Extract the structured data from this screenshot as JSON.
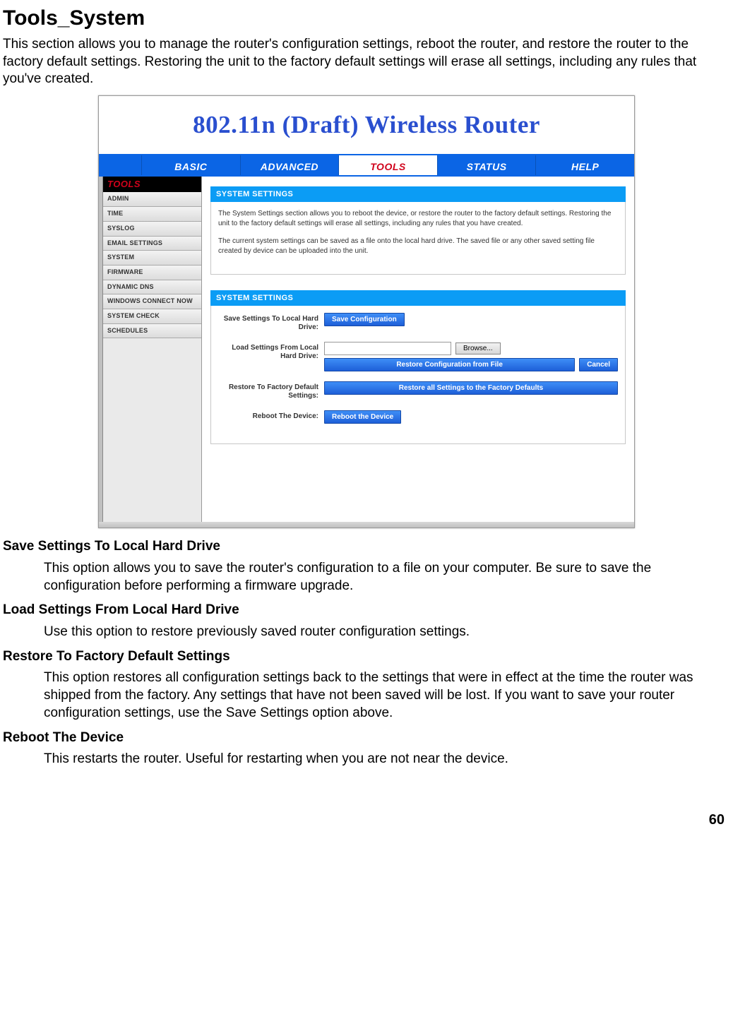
{
  "doc": {
    "title": "Tools_System",
    "intro": "This section allows you to manage the router's configuration settings, reboot the router, and restore the router to the factory default settings. Restoring the unit to the factory default settings will erase all settings, including any rules that you've created.",
    "page_number": "60"
  },
  "banner": {
    "title": "802.11n (Draft) Wireless Router"
  },
  "topnav": {
    "items": [
      "BASIC",
      "ADVANCED",
      "TOOLS",
      "STATUS",
      "HELP"
    ],
    "active_index": 2
  },
  "sidebar": {
    "header": "TOOLS",
    "items": [
      "ADMIN",
      "TIME",
      "SYSLOG",
      "EMAIL SETTINGS",
      "SYSTEM",
      "FIRMWARE",
      "DYNAMIC DNS",
      "WINDOWS CONNECT NOW",
      "SYSTEM CHECK",
      "SCHEDULES"
    ]
  },
  "panels": {
    "settings_title": "SYSTEM SETTINGS",
    "intro_p1": "The System Settings section allows you to reboot the device, or restore the router to the factory default settings. Restoring the unit to the factory default settings will erase all settings, including any rules that you have created.",
    "intro_p2": "The current system settings can be saved as a file onto the local hard drive. The saved file or any other saved setting file created by device can be uploaded into the unit.",
    "form_title": "SYSTEM SETTINGS",
    "rows": {
      "save": {
        "label": "Save Settings To Local Hard Drive:",
        "button": "Save Configuration"
      },
      "load": {
        "label": "Load Settings From Local Hard Drive:",
        "browse": "Browse...",
        "restore": "Restore Configuration from File",
        "cancel": "Cancel"
      },
      "factory": {
        "label": "Restore To Factory Default Settings:",
        "button": "Restore all Settings to the Factory Defaults"
      },
      "reboot": {
        "label": "Reboot The Device:",
        "button": "Reboot the Device"
      }
    }
  },
  "sections": [
    {
      "head": "Save Settings To Local Hard Drive",
      "body": "This option allows you to save the router's configuration to a file on your computer. Be sure to save the configuration before performing a firmware upgrade."
    },
    {
      "head": "Load Settings From Local Hard Drive",
      "body": "Use this option to restore previously saved router configuration settings."
    },
    {
      "head": "Restore To Factory Default Settings",
      "body": "This option restores all configuration settings back to the settings that were in effect at the time the router was shipped from the factory. Any settings that have not been saved will be lost. If you want to save your router configuration settings, use the Save Settings option above."
    },
    {
      "head": "Reboot The Device",
      "body": "This restarts the router. Useful for restarting when you are not near the device."
    }
  ]
}
